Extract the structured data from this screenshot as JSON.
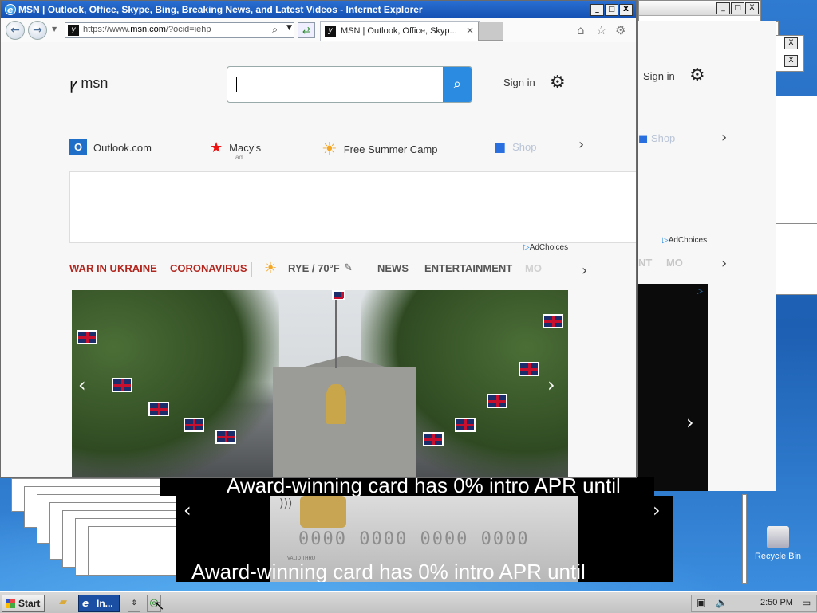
{
  "window": {
    "title": "MSN | Outlook, Office, Skype, Bing, Breaking News, and Latest Videos - Internet Explorer",
    "caption_buttons": [
      "_",
      "□",
      "X"
    ]
  },
  "browser": {
    "back_icon": "back-arrow-icon",
    "forward_icon": "forward-arrow-icon",
    "address_prefix": "https://www.",
    "address_domain": "msn.com",
    "address_suffix": "/?ocid=iehp",
    "tab_label": "MSN | Outlook, Office, Skyp...",
    "tab_close": "×"
  },
  "msn": {
    "logo_text": "msn",
    "search_value": "",
    "search_icon": "⌕",
    "sign_in": "Sign in",
    "settings_icon": "⚙"
  },
  "quicklinks": [
    {
      "label": "Outlook.com",
      "icon": "outlook-icon",
      "glyph": "O",
      "color": "#1f6fc9"
    },
    {
      "label": "Macy's",
      "sub": "ad",
      "icon": "macys-star-icon",
      "glyph": "★",
      "color": "#e11"
    },
    {
      "label": "Free Summer Camp",
      "icon": "sun-icon",
      "glyph": "☀",
      "color": "#f5a623"
    },
    {
      "label": "Shop",
      "icon": "shopping-cart-icon",
      "glyph": "🛒",
      "color": "#2a6fe0"
    }
  ],
  "quicklinks_next": "›",
  "adchoices": "AdChoices",
  "navrow": {
    "items": [
      {
        "label": "WAR IN UKRAINE",
        "style": "red"
      },
      {
        "label": "CORONAVIRUS",
        "style": "red"
      },
      {
        "label": "RYE / 70°F",
        "style": "gray"
      },
      {
        "label": "NEWS",
        "style": "gray"
      },
      {
        "label": "ENTERTAINMENT",
        "style": "gray"
      },
      {
        "label": "MO",
        "style": "fade"
      }
    ],
    "weather_icon": "☀",
    "edit_icon": "✎",
    "next": "›"
  },
  "hero": {
    "prev": "‹",
    "next": "›"
  },
  "second_window": {
    "sign_in": "Sign in",
    "settings_icon": "⚙",
    "shop": "Shop",
    "adchoices": "AdChoices",
    "nav_partial": [
      "NT",
      "MO"
    ],
    "next": "›"
  },
  "slideshow": {
    "caption": "Award-winning card has 0% intro APR until",
    "card_numbers": "0000 0000 0000 0000",
    "valid_thru": "VALID THRU",
    "prev": "‹",
    "next": "›"
  },
  "desktop": {
    "recycle_bin": "Recycle Bin"
  },
  "taskbar": {
    "start": "Start",
    "ie_item": "In...",
    "clock": "2:50 PM"
  },
  "colors": {
    "accent": "#2a8be0",
    "nav_red": "#b3261e",
    "title_blue": "#1450b3"
  }
}
